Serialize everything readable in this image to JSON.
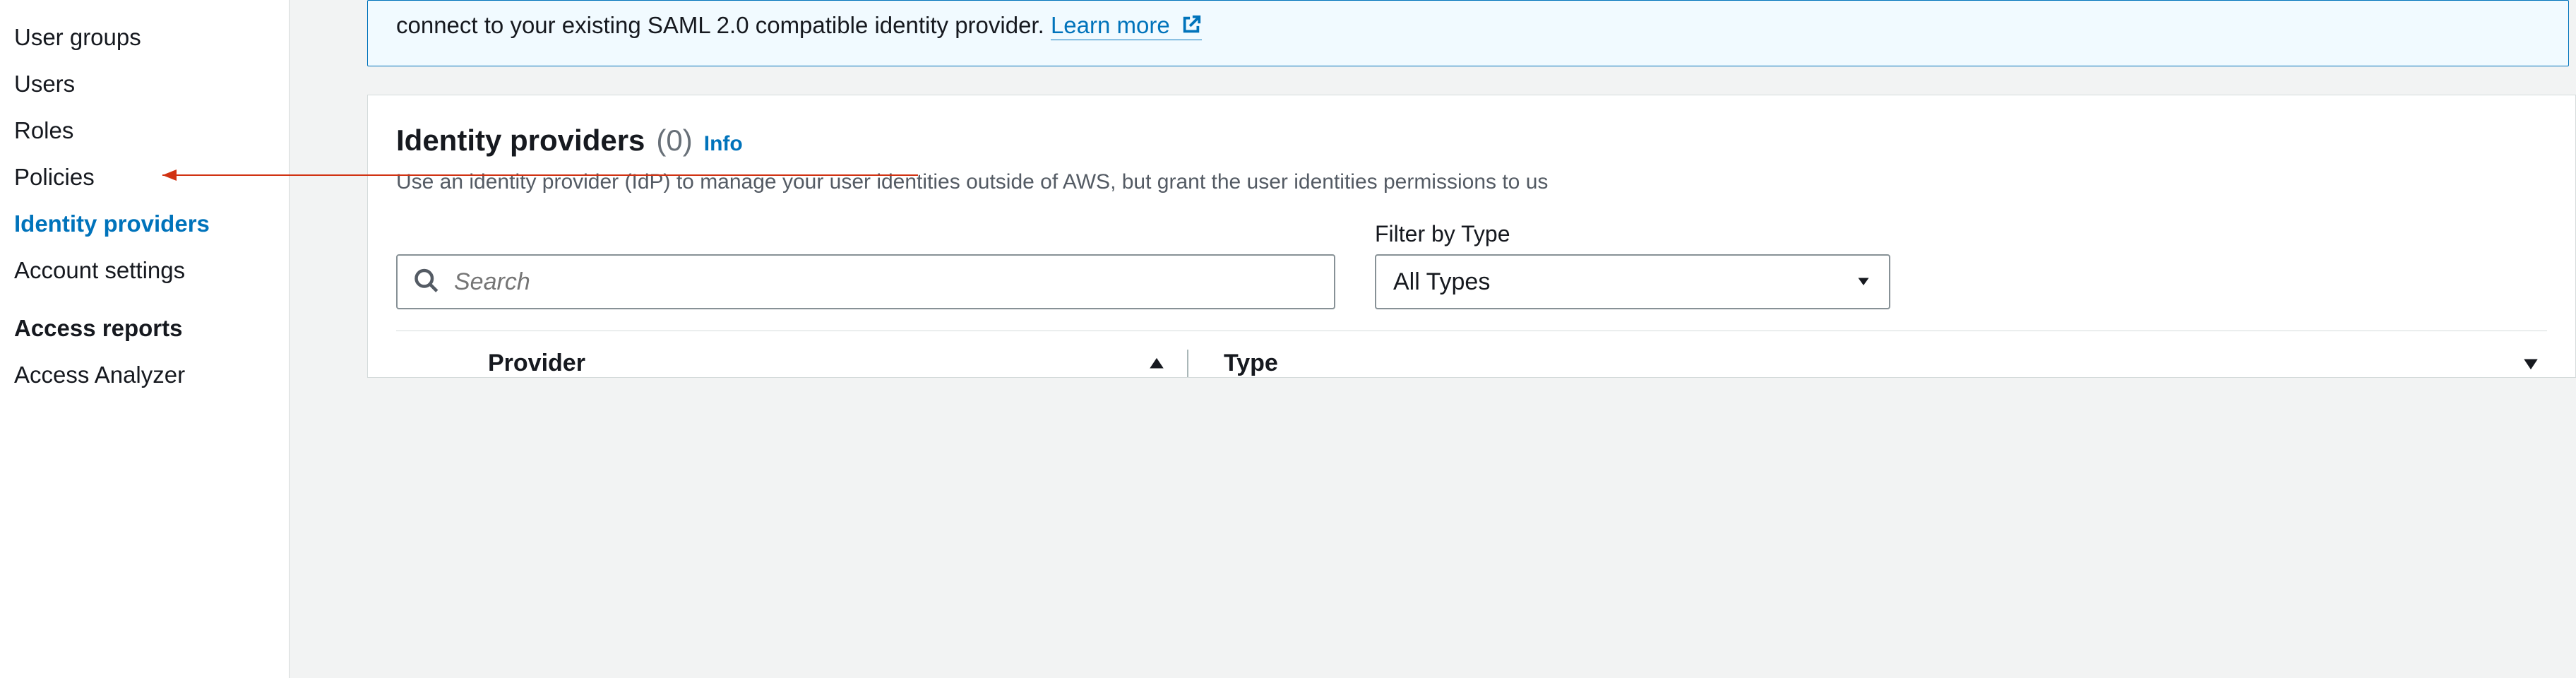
{
  "sidebar": {
    "items": [
      {
        "label": "User groups",
        "active": false
      },
      {
        "label": "Users",
        "active": false
      },
      {
        "label": "Roles",
        "active": false
      },
      {
        "label": "Policies",
        "active": false
      },
      {
        "label": "Identity providers",
        "active": true
      },
      {
        "label": "Account settings",
        "active": false
      }
    ],
    "section_title": "Access reports",
    "section_items": [
      {
        "label": "Access Analyzer"
      }
    ]
  },
  "info_box": {
    "text": "connect to your existing SAML 2.0 compatible identity provider. ",
    "link_text": "Learn more"
  },
  "panel": {
    "title": "Identity providers",
    "count": "(0)",
    "info_link": "Info",
    "description": "Use an identity provider (IdP) to manage your user identities outside of AWS, but grant the user identities permissions to us"
  },
  "search": {
    "placeholder": "Search"
  },
  "filter": {
    "label": "Filter by Type",
    "selected": "All Types"
  },
  "table": {
    "columns": [
      {
        "label": "Provider"
      },
      {
        "label": "Type"
      }
    ]
  }
}
